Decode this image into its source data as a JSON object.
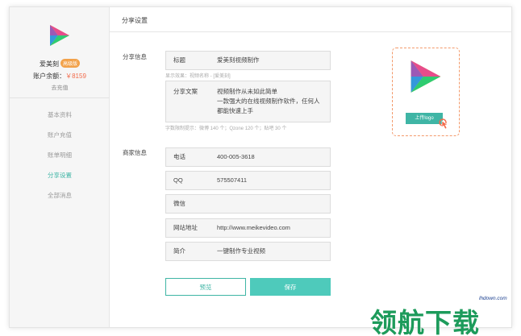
{
  "sidebar": {
    "username": "爱美刻",
    "user_badge": "高级版",
    "balance_label": "账户余额：",
    "balance_value": "￥8159",
    "recharge_link": "去充值",
    "nav_items": [
      {
        "label": "基本资料",
        "active": false
      },
      {
        "label": "账户充值",
        "active": false
      },
      {
        "label": "账单明细",
        "active": false
      },
      {
        "label": "分享设置",
        "active": true
      },
      {
        "label": "全部消息",
        "active": false
      }
    ]
  },
  "main": {
    "title": "分享设置",
    "share_section": {
      "label": "分享信息",
      "title_field": {
        "label": "标题",
        "value": "爱美刻视频制作"
      },
      "title_hint": "显示效果：视频名称 - [爱美刻]",
      "copy_field": {
        "label": "分享文案",
        "lines": [
          "视频制作从未如此简单",
          "一款强大的在线视频制作软件，任何人",
          "都能快速上手"
        ]
      },
      "copy_hint": "字数限制提示：微博 140 个；Qzone 120 个；贴吧 30 个"
    },
    "merchant_section": {
      "label": "商家信息",
      "fields": [
        {
          "label": "电话",
          "value": "400-005-3618"
        },
        {
          "label": "QQ",
          "value": "575507411"
        },
        {
          "label": "微信",
          "value": ""
        },
        {
          "label": "网站地址",
          "value": "http://www.meikevideo.com"
        },
        {
          "label": "简介",
          "value": "一键制作专业视频"
        }
      ]
    },
    "upload_logo_label": "上传logo",
    "preview_button": "预览",
    "save_button": "保存"
  },
  "watermark": {
    "url": "lhdown.com",
    "text": "领航下载"
  },
  "colors": {
    "accent": "#3fb5a5",
    "save_bg": "#4ecabb",
    "balance": "#f26b4b",
    "badge": "#f2a24b",
    "upload_border": "#f39a6b"
  }
}
